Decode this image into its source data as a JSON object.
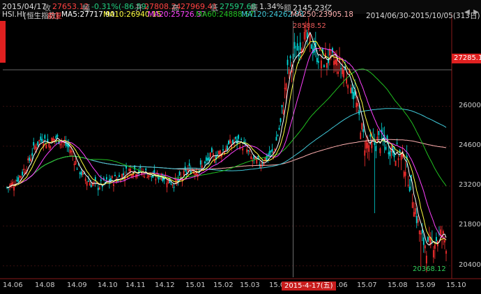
{
  "header": {
    "date": "2015/04/17",
    "close_label": "收",
    "close": "27653.12",
    "change_label": "幅",
    "change": "-0.31%(-86.59)",
    "open_label": "开",
    "open": "27808.24",
    "high_label": "高",
    "high": "27969.41",
    "low_label": "低",
    "low": "27597.68",
    "amp_label": "振",
    "amp": "1.34%",
    "amount_label": "额",
    "amount": "2145.23亿",
    "range": "2014/06/30-2015/10/05(313日)"
  },
  "ma_bar": {
    "symbol": "HSI.HI",
    "name": "[恒生指数]",
    "adj": "前复",
    "ma5": "MA5:27717.90",
    "ma10": "MA10:26940.15",
    "ma20": "MA20:25726.37",
    "ma60": "MA60:24888.57",
    "ma120": "MA120:24262.83",
    "ma250": "MA250:23905.18"
  },
  "colors": {
    "up": "#ff3030",
    "down": "#00d8d8",
    "ma5": "#ffffff",
    "ma10": "#ffff40",
    "ma20": "#ff40ff",
    "ma60": "#20c020",
    "ma120": "#40c8d8",
    "ma250": "#ffb0b0"
  },
  "icons": [
    "prev-icon",
    "next-icon"
  ],
  "annotations": {
    "high_marker": "28588.52",
    "low_marker": "20368.12",
    "current_price": "27285.1",
    "cursor_date": "2015-4-17(五)"
  },
  "chart_data": {
    "type": "candlestick",
    "y_ticks": [
      20400,
      21800,
      23200,
      24600,
      26000
    ],
    "ylim": [
      20000,
      29000
    ],
    "x_ticks": [
      "14.06",
      "14.08",
      "14.09",
      "14.10",
      "14.11",
      "14.12",
      "15.01",
      "15.02",
      "15.03",
      "15.04",
      "15.06",
      "15.07",
      "15.08",
      "15.09",
      "15.10"
    ],
    "close_path": [
      [
        0,
        23150
      ],
      [
        5,
        23300
      ],
      [
        10,
        23600
      ],
      [
        15,
        24000
      ],
      [
        20,
        24600
      ],
      [
        25,
        24900
      ],
      [
        30,
        24700
      ],
      [
        35,
        24900
      ],
      [
        40,
        24750
      ],
      [
        45,
        24500
      ],
      [
        50,
        23900
      ],
      [
        55,
        23500
      ],
      [
        60,
        23300
      ],
      [
        65,
        23200
      ],
      [
        70,
        23300
      ],
      [
        75,
        23400
      ],
      [
        80,
        23500
      ],
      [
        85,
        23700
      ],
      [
        90,
        23800
      ],
      [
        95,
        23700
      ],
      [
        100,
        23650
      ],
      [
        105,
        23500
      ],
      [
        110,
        23600
      ],
      [
        115,
        23400
      ],
      [
        120,
        23300
      ],
      [
        125,
        23500
      ],
      [
        130,
        23800
      ],
      [
        135,
        23750
      ],
      [
        140,
        23900
      ],
      [
        145,
        24200
      ],
      [
        150,
        24300
      ],
      [
        155,
        24500
      ],
      [
        160,
        24700
      ],
      [
        165,
        24800
      ],
      [
        170,
        24550
      ],
      [
        175,
        24100
      ],
      [
        180,
        24000
      ],
      [
        185,
        24200
      ],
      [
        190,
        24400
      ],
      [
        195,
        25400
      ],
      [
        200,
        27200
      ],
      [
        205,
        27800
      ],
      [
        210,
        28300
      ],
      [
        215,
        28400
      ],
      [
        220,
        27900
      ],
      [
        225,
        27600
      ],
      [
        230,
        27700
      ],
      [
        235,
        27500
      ],
      [
        240,
        27300
      ],
      [
        245,
        26900
      ],
      [
        250,
        25800
      ],
      [
        255,
        24700
      ],
      [
        260,
        24600
      ],
      [
        265,
        24800
      ],
      [
        270,
        24700
      ],
      [
        275,
        24500
      ],
      [
        280,
        24300
      ],
      [
        285,
        23800
      ],
      [
        290,
        22600
      ],
      [
        295,
        21400
      ],
      [
        300,
        21000
      ],
      [
        305,
        21300
      ],
      [
        310,
        21500
      ],
      [
        313,
        21200
      ]
    ]
  }
}
